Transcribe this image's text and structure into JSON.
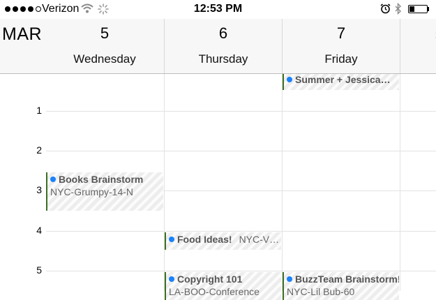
{
  "status_bar": {
    "carrier": "Verizon",
    "time": "12:53 PM",
    "battery_level": 0.3
  },
  "header": {
    "month": "MAR",
    "days": [
      {
        "number": "5",
        "name": "Wednesday"
      },
      {
        "number": "6",
        "name": "Thursday"
      },
      {
        "number": "7",
        "name": "Friday"
      },
      {
        "number": "",
        "name": "S"
      }
    ]
  },
  "hours": [
    "1",
    "2",
    "3",
    "4",
    "5"
  ],
  "events": {
    "summer": {
      "title": "Summer + Jessica…"
    },
    "books": {
      "title": "Books Brainstorm",
      "location": "NYC-Grumpy-14-N"
    },
    "food": {
      "title": "Food Ideas!",
      "location": "NYC-V…"
    },
    "copyright": {
      "title": "Copyright 101",
      "location": "LA-BOO-Conference"
    },
    "buzzteam": {
      "title": "BuzzTeam Brainstorm!",
      "location": "NYC-Lil Bub-60"
    }
  },
  "colors": {
    "event_dot": "#1a82fb",
    "event_bar": "#3b6e22",
    "header_bg": "#f7f7f7"
  }
}
